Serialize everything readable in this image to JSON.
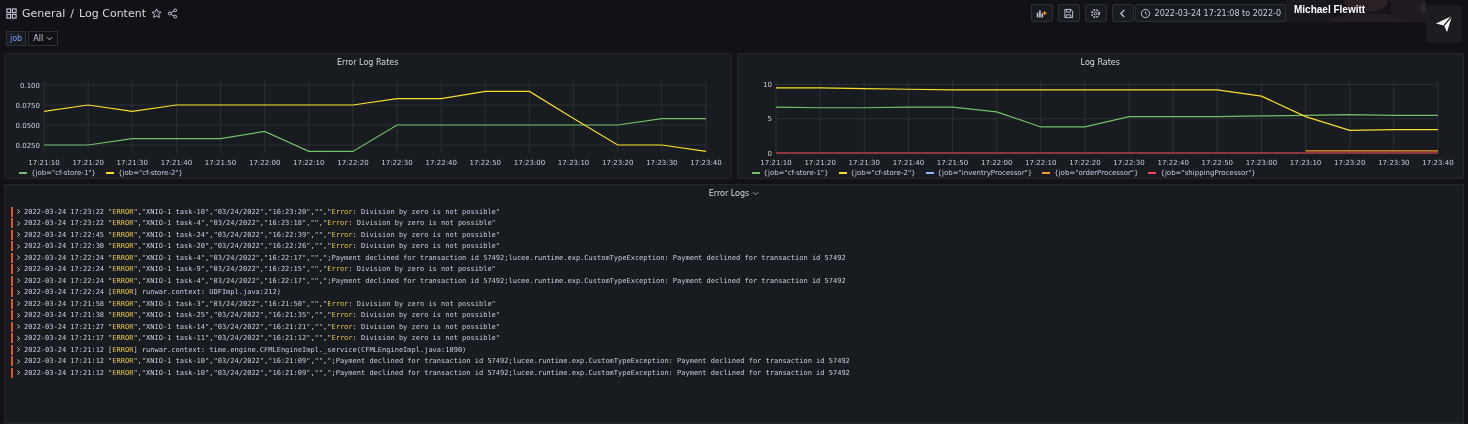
{
  "header": {
    "folder": "General",
    "separator": "/",
    "title": "Log Content",
    "starred": false,
    "time_range": "2022-03-24 17:21:08 to 2022-0"
  },
  "overlay": {
    "name": "Michael Flewitt"
  },
  "variables": [
    {
      "label": "job",
      "value": "All"
    }
  ],
  "panels": [
    {
      "title": "Error Log Rates",
      "chart_data": {
        "type": "line",
        "grid": true,
        "x": [
          "17:21:10",
          "17:21:20",
          "17:21:30",
          "17:21:40",
          "17:21:50",
          "17:22:00",
          "17:22:10",
          "17:22:20",
          "17:22:30",
          "17:22:40",
          "17:22:50",
          "17:23:00",
          "17:23:10",
          "17:23:20",
          "17:23:30",
          "17:23:40"
        ],
        "ylim": [
          0.015,
          0.105
        ],
        "yticks": [
          {
            "value": 0.025,
            "label": "0.0250"
          },
          {
            "value": 0.05,
            "label": "0.0500"
          },
          {
            "value": 0.075,
            "label": "0.0750"
          },
          {
            "value": 0.1,
            "label": "0.100"
          }
        ],
        "series": [
          {
            "name": "{job=\"cf-store-1\"}",
            "color": "#73bf69",
            "values": [
              0.025,
              0.025,
              0.033,
              0.033,
              0.033,
              0.042,
              0.017,
              0.017,
              0.05,
              0.05,
              0.05,
              0.05,
              0.05,
              0.05,
              0.058,
              0.058
            ]
          },
          {
            "name": "{job=\"cf-store-2\"}",
            "color": "#fade2a",
            "values": [
              0.067,
              0.075,
              0.067,
              0.075,
              0.075,
              0.075,
              0.075,
              0.075,
              0.083,
              0.083,
              0.092,
              0.092,
              0.058,
              0.025,
              0.025,
              0.017
            ]
          }
        ]
      }
    },
    {
      "title": "Log Rates",
      "chart_data": {
        "type": "line",
        "grid": true,
        "x": [
          "17:21:10",
          "17:21:20",
          "17:21:30",
          "17:21:40",
          "17:21:50",
          "17:22:00",
          "17:22:10",
          "17:22:20",
          "17:22:30",
          "17:22:40",
          "17:22:50",
          "17:23:00",
          "17:23:10",
          "17:23:20",
          "17:23:30",
          "17:23:40"
        ],
        "ylim": [
          0,
          10.5
        ],
        "yticks": [
          0,
          5,
          10
        ],
        "series": [
          {
            "name": "{job=\"cf-store-1\"}",
            "color": "#73bf69",
            "values": [
              6.7,
              6.6,
              6.6,
              6.7,
              6.7,
              6,
              3.8,
              3.8,
              5.3,
              5.3,
              5.3,
              5.4,
              5.5,
              5.6,
              5.5,
              5.5
            ]
          },
          {
            "name": "{job=\"cf-store-2\"}",
            "color": "#fade2a",
            "values": [
              9.5,
              9.5,
              9.4,
              9.3,
              9.2,
              9.2,
              9.2,
              9.2,
              9.2,
              9.2,
              9.2,
              8.3,
              5.3,
              3.3,
              3.4,
              3.4
            ]
          },
          {
            "name": "{job=\"inventryProcessor\"}",
            "color": "#8ab8ff",
            "values": [
              null,
              null,
              null,
              null,
              null,
              null,
              null,
              null,
              null,
              null,
              null,
              null,
              null,
              null,
              null,
              null
            ]
          },
          {
            "name": "{job=\"orderProcessor\"}",
            "color": "#ff9830",
            "values": [
              null,
              null,
              null,
              null,
              null,
              null,
              null,
              null,
              null,
              null,
              null,
              null,
              0.3,
              0.3,
              0.3,
              0.3
            ]
          },
          {
            "name": "{job=\"shippingProcessor\"}",
            "color": "#f2495c",
            "values": [
              0,
              0,
              0,
              0,
              0,
              0,
              0,
              0,
              0,
              0,
              0,
              0,
              0,
              0,
              0,
              0
            ]
          }
        ]
      }
    }
  ],
  "logs": {
    "title": "Error Logs",
    "lines": [
      {
        "time": "2022-03-24 17:23:22",
        "parts": [
          {
            "t": "\"",
            "hl": false
          },
          {
            "t": "ERROR",
            "hl": true
          },
          {
            "t": "\",\"XNIO-1 task-10\",\"03/24/2022\",\"16:23:20\",\"\",\"",
            "hl": false
          },
          {
            "t": "Error",
            "hl": true
          },
          {
            "t": ": Division by zero is not possible\"",
            "hl": false
          }
        ]
      },
      {
        "time": "2022-03-24 17:23:22",
        "parts": [
          {
            "t": "\"",
            "hl": false
          },
          {
            "t": "ERROR",
            "hl": true
          },
          {
            "t": "\",\"XNIO-1 task-4\",\"03/24/2022\",\"16:23:18\",\"\",\"",
            "hl": false
          },
          {
            "t": "Error",
            "hl": true
          },
          {
            "t": ": Division by zero is not possible\"",
            "hl": false
          }
        ]
      },
      {
        "time": "2022-03-24 17:22:45",
        "parts": [
          {
            "t": "\"",
            "hl": false
          },
          {
            "t": "ERROR",
            "hl": true
          },
          {
            "t": "\",\"XNIO-1 task-24\",\"03/24/2022\",\"16:22:39\",\"\",\"",
            "hl": false
          },
          {
            "t": "Error",
            "hl": true
          },
          {
            "t": ": Division by zero is not possible\"",
            "hl": false
          }
        ]
      },
      {
        "time": "2022-03-24 17:22:30",
        "parts": [
          {
            "t": "\"",
            "hl": false
          },
          {
            "t": "ERROR",
            "hl": true
          },
          {
            "t": "\",\"XNIO-1 task-20\",\"03/24/2022\",\"16:22:26\",\"\",\"",
            "hl": false
          },
          {
            "t": "Error",
            "hl": true
          },
          {
            "t": ": Division by zero is not possible\"",
            "hl": false
          }
        ]
      },
      {
        "time": "2022-03-24 17:22:24",
        "parts": [
          {
            "t": "\"",
            "hl": false
          },
          {
            "t": "ERROR",
            "hl": true
          },
          {
            "t": "\",\"XNIO-1 task-4\",\"03/24/2022\",\"16:22:17\",\"\",\";Payment declined for transaction id 57492;lucee.runtime.exp.CustomTypeException: Payment declined for transaction id 57492",
            "hl": false
          }
        ]
      },
      {
        "time": "2022-03-24 17:22:24",
        "parts": [
          {
            "t": "\"",
            "hl": false
          },
          {
            "t": "ERROR",
            "hl": true
          },
          {
            "t": "\",\"XNIO-1 task-9\",\"03/24/2022\",\"16:22:15\",\"\",\"",
            "hl": false
          },
          {
            "t": "Error",
            "hl": true
          },
          {
            "t": ": Division by zero is not possible\"",
            "hl": false
          }
        ]
      },
      {
        "time": "2022-03-24 17:22:24",
        "parts": [
          {
            "t": "\"",
            "hl": false
          },
          {
            "t": "ERROR",
            "hl": true
          },
          {
            "t": "\",\"XNIO-1 task-4\",\"03/24/2022\",\"16:22:17\",\"\",\";Payment declined for transaction id 57492;lucee.runtime.exp.CustomTypeException: Payment declined for transaction id 57492",
            "hl": false
          }
        ]
      },
      {
        "time": "2022-03-24 17:22:24",
        "parts": [
          {
            "t": "[",
            "hl": false
          },
          {
            "t": "ERROR",
            "hl": true
          },
          {
            "t": "] runwar.context: UDFImpl.java:212)",
            "hl": false
          }
        ]
      },
      {
        "time": "2022-03-24 17:21:58",
        "parts": [
          {
            "t": "\"",
            "hl": false
          },
          {
            "t": "ERROR",
            "hl": true
          },
          {
            "t": "\",\"XNIO-1 task-3\",\"03/24/2022\",\"16:21:50\",\"\",\"",
            "hl": false
          },
          {
            "t": "Error",
            "hl": true
          },
          {
            "t": ": Division by zero is not possible\"",
            "hl": false
          }
        ]
      },
      {
        "time": "2022-03-24 17:21:38",
        "parts": [
          {
            "t": "\"",
            "hl": false
          },
          {
            "t": "ERROR",
            "hl": true
          },
          {
            "t": "\",\"XNIO-1 task-25\",\"03/24/2022\",\"16:21:35\",\"\",\"",
            "hl": false
          },
          {
            "t": "Error",
            "hl": true
          },
          {
            "t": ": Division by zero is not possible\"",
            "hl": false
          }
        ]
      },
      {
        "time": "2022-03-24 17:21:27",
        "parts": [
          {
            "t": "\"",
            "hl": false
          },
          {
            "t": "ERROR",
            "hl": true
          },
          {
            "t": "\",\"XNIO-1 task-14\",\"03/24/2022\",\"16:21:21\",\"\",\"",
            "hl": false
          },
          {
            "t": "Error",
            "hl": true
          },
          {
            "t": ": Division by zero is not possible\"",
            "hl": false
          }
        ]
      },
      {
        "time": "2022-03-24 17:21:17",
        "parts": [
          {
            "t": "\"",
            "hl": false
          },
          {
            "t": "ERROR",
            "hl": true
          },
          {
            "t": "\",\"XNIO-1 task-11\",\"03/24/2022\",\"16:21:12\",\"\",\"",
            "hl": false
          },
          {
            "t": "Error",
            "hl": true
          },
          {
            "t": ": Division by zero is not possible\"",
            "hl": false
          }
        ]
      },
      {
        "time": "2022-03-24 17:21:12",
        "parts": [
          {
            "t": "[",
            "hl": false
          },
          {
            "t": "ERROR",
            "hl": true
          },
          {
            "t": "] runwar.context: time.engine.CFMLEngineImpl._service(CFMLEngineImpl.java:1090)",
            "hl": false
          }
        ]
      },
      {
        "time": "2022-03-24 17:21:12",
        "parts": [
          {
            "t": "\"",
            "hl": false
          },
          {
            "t": "ERROR",
            "hl": true
          },
          {
            "t": "\",\"XNIO-1 task-10\",\"03/24/2022\",\"16:21:09\",\"\",\";Payment declined for transaction id 57492;lucee.runtime.exp.CustomTypeException: Payment declined for transaction id 57492",
            "hl": false
          }
        ]
      },
      {
        "time": "2022-03-24 17:21:12",
        "parts": [
          {
            "t": "\"",
            "hl": false
          },
          {
            "t": "ERROR",
            "hl": true
          },
          {
            "t": "\",\"XNIO-1 task-10\",\"03/24/2022\",\"16:21:09\",\"\",\";Payment declined for transaction id 57492;lucee.runtime.exp.CustomTypeException: Payment declined for transaction id 57492",
            "hl": false
          }
        ]
      }
    ]
  }
}
